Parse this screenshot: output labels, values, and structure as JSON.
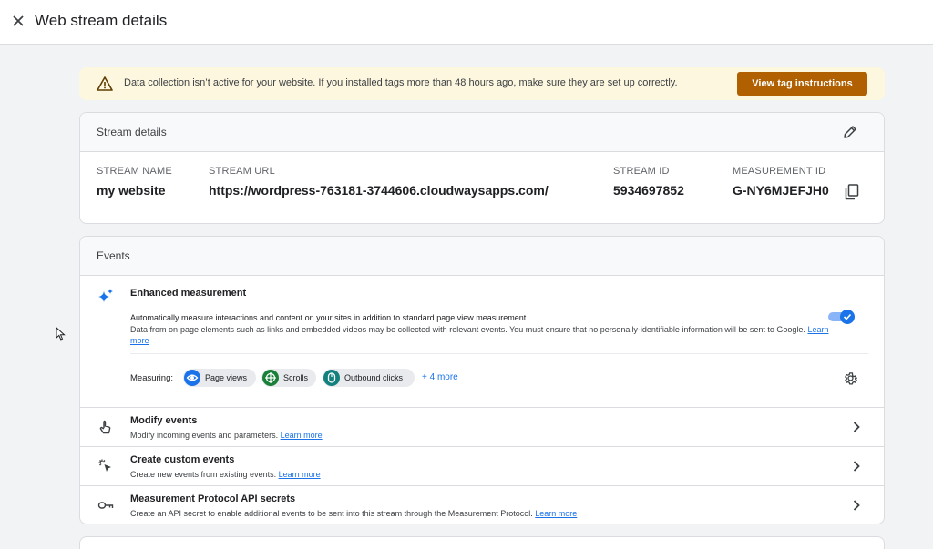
{
  "header": {
    "title": "Web stream details"
  },
  "banner": {
    "message": "Data collection isn’t active for your website. If you installed tags more than 48 hours ago, make sure they are set up correctly.",
    "button_label": "View tag instructions"
  },
  "stream_details": {
    "title": "Stream details",
    "fields": [
      {
        "label": "STREAM NAME",
        "value": "my website"
      },
      {
        "label": "STREAM URL",
        "value": "https://wordpress-763181-3744606.cloudwaysapps.com/"
      },
      {
        "label": "STREAM ID",
        "value": "5934697852"
      },
      {
        "label": "MEASUREMENT ID",
        "value": "G-NY6MJEFJH0"
      }
    ]
  },
  "events": {
    "title": "Events",
    "enhanced": {
      "title": "Enhanced measurement",
      "desc1": "Automatically measure interactions and content on your sites in addition to standard page view measurement.",
      "desc2": "Data from on-page elements such as links and embedded videos may be collected with relevant events. You must ensure that no personally-identifiable information will be sent to Google.",
      "learn_more": "Learn more",
      "enabled": true,
      "measuring_label": "Measuring:",
      "chips": [
        "Page views",
        "Scrolls",
        "Outbound clicks"
      ],
      "more_label": "+ 4 more"
    },
    "rows": [
      {
        "title": "Modify events",
        "desc": "Modify incoming events and parameters.",
        "link": "Learn more",
        "icon": "touch-icon"
      },
      {
        "title": "Create custom events",
        "desc": "Create new events from existing events.",
        "link": "Learn more",
        "icon": "cursor-sparkle-icon"
      },
      {
        "title": "Measurement Protocol API secrets",
        "desc": "Create an API secret to enable additional events to be sent into this stream through the Measurement Protocol.",
        "link": "Learn more",
        "icon": "key-icon"
      }
    ]
  },
  "colors": {
    "accent": "#1a73e8",
    "warning_bg": "#fef7e0",
    "warning_button": "#b06000"
  }
}
